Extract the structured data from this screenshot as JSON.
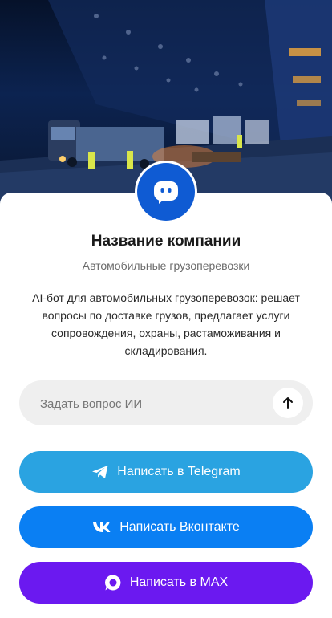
{
  "company": {
    "name": "Название компании",
    "subtitle": "Автомобильные грузоперевозки",
    "description": "AI-бот для автомобильных грузоперевозок: решает вопросы по доставке грузов, предлагает услуги сопровождения, охраны, растаможивания и складирования."
  },
  "ask": {
    "placeholder": "Задать вопрос ИИ"
  },
  "buttons": {
    "telegram": "Написать в Telegram",
    "vk": "Написать Вконтакте",
    "max": "Написать в MAX"
  },
  "colors": {
    "avatar": "#0f5bd3",
    "telegram": "#2aa3e1",
    "vk": "#0a7ff3",
    "max": "#6b19f0"
  },
  "icons": {
    "avatar": "bot-chat-icon",
    "send": "arrow-up-icon",
    "telegram": "telegram-icon",
    "vk": "vk-icon",
    "max": "max-icon"
  }
}
